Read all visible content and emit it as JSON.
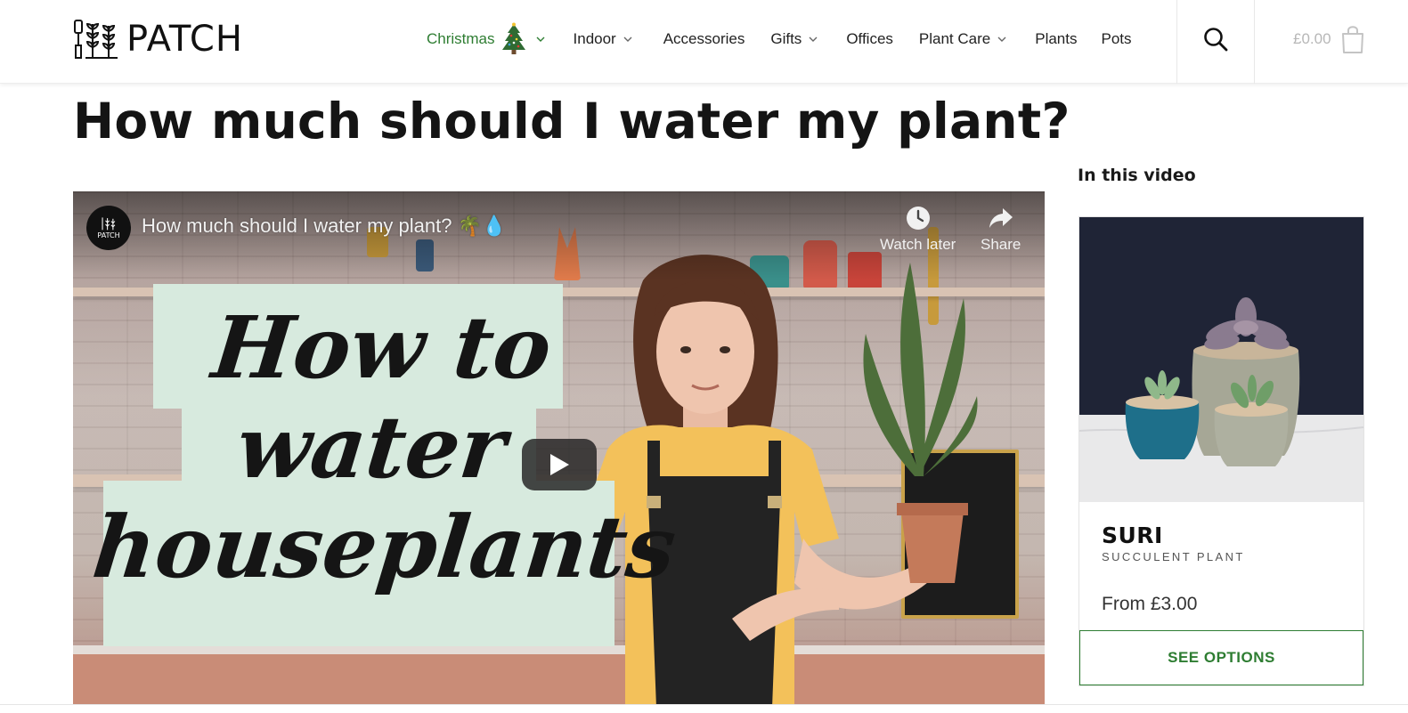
{
  "brand": {
    "name": "PATCH",
    "logo_icon": "trowel-and-plants-icon"
  },
  "nav": {
    "items": [
      {
        "label": "Christmas",
        "has_dropdown": true,
        "highlight_color": "#2e7d32",
        "icon": "christmas-tree-icon"
      },
      {
        "label": "Indoor",
        "has_dropdown": true
      },
      {
        "label": "Accessories",
        "has_dropdown": false
      },
      {
        "label": "Gifts",
        "has_dropdown": true
      },
      {
        "label": "Offices",
        "has_dropdown": false
      },
      {
        "label": "Plant Care",
        "has_dropdown": true
      },
      {
        "label": "Plants",
        "has_dropdown": false
      },
      {
        "label": "Pots",
        "has_dropdown": false
      }
    ],
    "search_icon": "search-icon",
    "cart": {
      "total": "£0.00",
      "icon": "shopping-bag-icon"
    }
  },
  "page": {
    "title": "How much should I water my plant?"
  },
  "video": {
    "channel_avatar_label": "PATCH",
    "title": "How much should I water my plant? 🌴💧",
    "watch_later_label": "Watch later",
    "share_label": "Share",
    "overlay_lines": [
      "How to",
      "water",
      "houseplants"
    ],
    "overlay_color": "#d7eade",
    "play_icon": "play-icon"
  },
  "sidebar": {
    "heading": "In this video",
    "product": {
      "name": "SURI",
      "subtitle": "SUCCULENT PLANT",
      "price": "From £3.00",
      "button_label": "SEE OPTIONS",
      "accent_color": "#2e7d32"
    }
  }
}
